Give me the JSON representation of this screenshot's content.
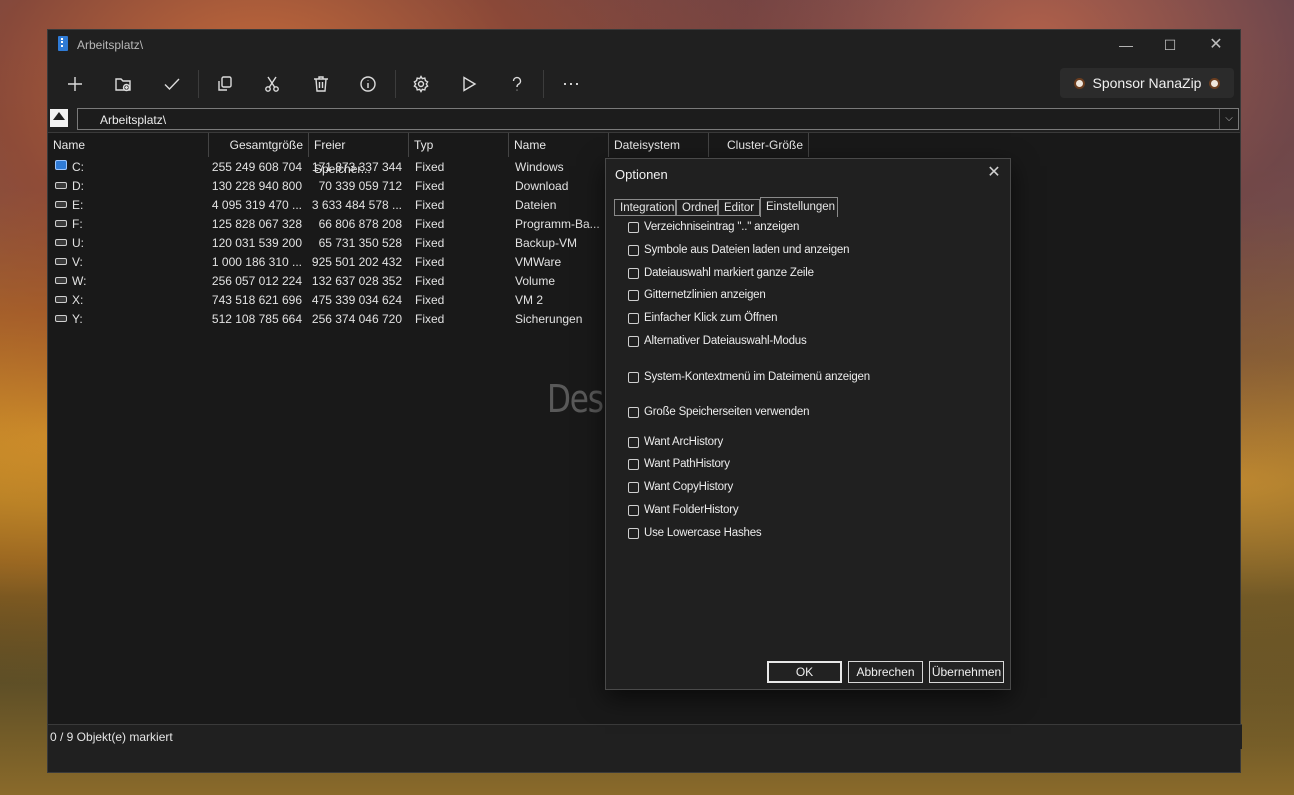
{
  "window": {
    "title": "Arbeitsplatz\\",
    "minimize": "—",
    "maximize": "☐",
    "close": "✕"
  },
  "toolbar": {
    "sponsor_label": "Sponsor NanaZip",
    "more_label": "⋯"
  },
  "address": {
    "path": "Arbeitsplatz\\",
    "dropdown": "⌵"
  },
  "list": {
    "headers": [
      "Name",
      "Gesamtgröße",
      "Freier Speicher...",
      "Typ",
      "Name",
      "Dateisystem",
      "Cluster-Größe"
    ],
    "rows": [
      {
        "name": "C:",
        "total": "255 249 608 704",
        "free": "171 873 337 344",
        "type": "Fixed",
        "label": "Windows"
      },
      {
        "name": "D:",
        "total": "130 228 940 800",
        "free": "70 339 059 712",
        "type": "Fixed",
        "label": "Download"
      },
      {
        "name": "E:",
        "total": "4 095 319 470 ...",
        "free": "3 633 484 578 ...",
        "type": "Fixed",
        "label": "Dateien"
      },
      {
        "name": "F:",
        "total": "125 828 067 328",
        "free": "66 806 878 208",
        "type": "Fixed",
        "label": "Programm-Ba..."
      },
      {
        "name": "U:",
        "total": "120 031 539 200",
        "free": "65 731 350 528",
        "type": "Fixed",
        "label": "Backup-VM"
      },
      {
        "name": "V:",
        "total": "1 000 186 310 ...",
        "free": "925 501 202 432",
        "type": "Fixed",
        "label": "VMWare"
      },
      {
        "name": "W:",
        "total": "256 057 012 224",
        "free": "132 637 028 352",
        "type": "Fixed",
        "label": "Volume"
      },
      {
        "name": "X:",
        "total": "743 518 621 696",
        "free": "475 339 034 624",
        "type": "Fixed",
        "label": "VM 2"
      },
      {
        "name": "Y:",
        "total": "512 108 785 664",
        "free": "256 374 046 720",
        "type": "Fixed",
        "label": "Sicherungen"
      }
    ]
  },
  "status": {
    "text": "0 / 9 Objekt(e) markiert"
  },
  "dialog": {
    "title": "Optionen",
    "close": "✕",
    "tabs": [
      "Integration",
      "Ordner",
      "Editor",
      "Einstellungen"
    ],
    "active_tab": "Einstellungen",
    "options": [
      {
        "label": "Verzeichniseintrag \"..\" anzeigen",
        "checked": false
      },
      {
        "label": "Symbole aus Dateien laden und anzeigen",
        "checked": false
      },
      {
        "label": "Dateiauswahl markiert ganze Zeile",
        "checked": false
      },
      {
        "label": "Gitternetzlinien anzeigen",
        "checked": false
      },
      {
        "label": "Einfacher Klick zum Öffnen",
        "checked": false
      },
      {
        "label": "Alternativer Dateiauswahl-Modus",
        "checked": false
      },
      {
        "label": "System-Kontextmenü im Dateimenü anzeigen",
        "checked": false
      },
      {
        "label": "Große Speicherseiten verwenden",
        "checked": false
      },
      {
        "label": "Want ArcHistory",
        "checked": false
      },
      {
        "label": "Want PathHistory",
        "checked": false
      },
      {
        "label": "Want CopyHistory",
        "checked": false
      },
      {
        "label": "Want FolderHistory",
        "checked": false
      },
      {
        "label": "Use Lowercase Hashes",
        "checked": false
      }
    ],
    "buttons": {
      "ok": "OK",
      "cancel": "Abbrechen",
      "apply": "Übernehmen"
    }
  },
  "watermark": "Deskmodder.de"
}
